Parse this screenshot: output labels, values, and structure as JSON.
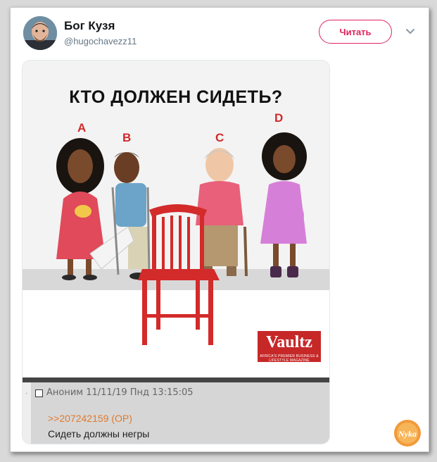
{
  "tweet": {
    "author_name": "Бог Кузя",
    "author_handle": "@hugochavezz11",
    "follow_label": "Читать",
    "accent_color": "#e0245e"
  },
  "image": {
    "title": "КТО ДОЛЖЕН СИДЕТЬ?",
    "letters": [
      "A",
      "B",
      "C",
      "D"
    ],
    "logo_text": "Vaultz",
    "logo_tagline": "AFRICA'S PREMIER BUSINESS & LIFESTYLE MAGAZINE"
  },
  "post": {
    "meta": "Аноним 11/11/19 Пнд 13:15:05",
    "reply_link": ">>207242159 (OP)",
    "text": "Сидеть должны негры"
  },
  "watermark": {
    "text": "Nyka"
  },
  "icons": [
    "chevron-down-icon",
    "checkbox-icon"
  ]
}
